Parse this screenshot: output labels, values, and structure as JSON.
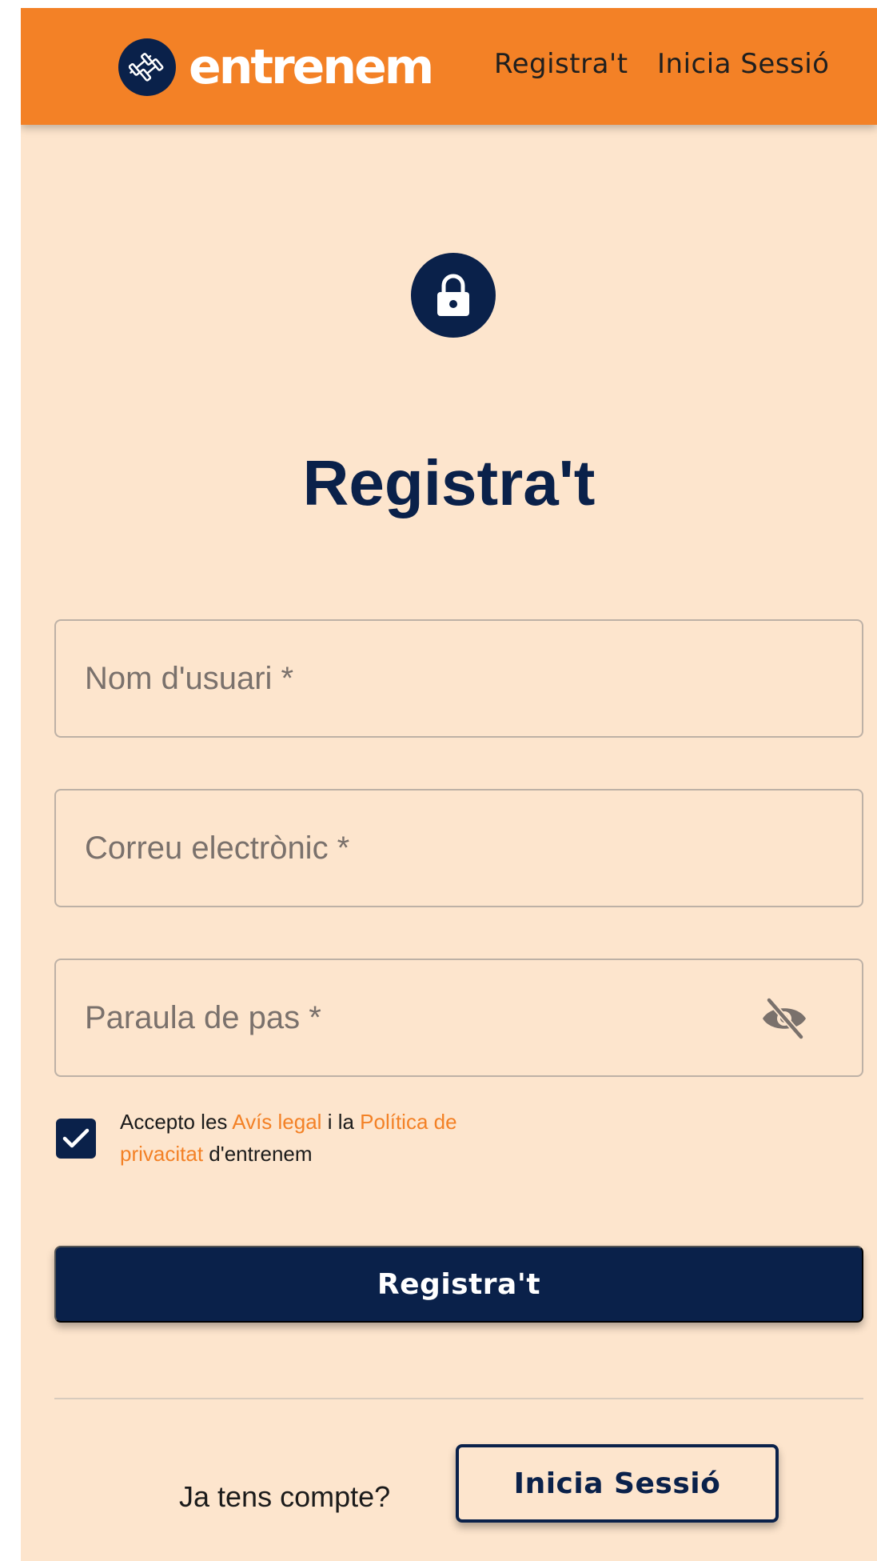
{
  "header": {
    "brand": "entrenem",
    "nav": {
      "register": "Registra't",
      "login": "Inicia Sessió"
    }
  },
  "form": {
    "title": "Registra't",
    "username": {
      "placeholder": "Nom d'usuari *",
      "value": ""
    },
    "email": {
      "placeholder": "Correu electrònic *",
      "value": ""
    },
    "password": {
      "placeholder": "Paraula de pas *",
      "value": ""
    },
    "consent": {
      "checked": true,
      "prefix": "Accepto les ",
      "legal_link": "Avís legal",
      "middle": " i la ",
      "privacy_link": "Política de privacitat",
      "suffix": " d'entrenem"
    },
    "submit_label": "Registra't"
  },
  "footer": {
    "prompt": "Ja tens compte?",
    "login_button": "Inicia Sessió"
  },
  "colors": {
    "header": "#f38126",
    "background": "#fde5cd",
    "primary": "#0a214a",
    "link": "#f38126"
  },
  "icons": {
    "brand": "dumbbell-icon",
    "lock": "lock-icon",
    "password_toggle": "eye-off-icon",
    "checkbox": "check-icon"
  }
}
